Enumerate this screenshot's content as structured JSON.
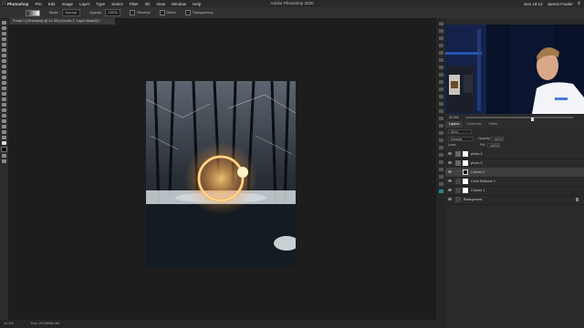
{
  "menubar": {
    "items": [
      "Photoshop",
      "File",
      "Edit",
      "Image",
      "Layer",
      "Type",
      "Select",
      "Filter",
      "3D",
      "View",
      "Window",
      "Help"
    ],
    "clock": "Sun 19:12",
    "user": "James Fowler"
  },
  "window_title": "Adobe Photoshop 2020",
  "options_bar": {
    "mode_label": "Mode:",
    "mode_value": "Normal",
    "opacity_label": "Opacity:",
    "opacity_value": "100%",
    "reverse_label": "Reverse",
    "dither_label": "Dither",
    "transparency_label": "Transparency"
  },
  "document_tab": "Portal 1 (Otherland) @ 41.3% (Curves 2, Layer Mask/8) *",
  "status_bar": {
    "zoom": "41.3%",
    "doc": "Doc: 20.0M/88.4M"
  },
  "navigator": {
    "zoom": "41.3%"
  },
  "panel_tabs": [
    "Layers",
    "Channels",
    "Paths"
  ],
  "layers_panel": {
    "kind_filter": "Kind",
    "blend_mode": "Normal",
    "opacity_label": "Opacity:",
    "opacity_value": "100%",
    "lock_label": "Lock:",
    "fill_label": "Fill:",
    "fill_value": "100%",
    "layers": [
      {
        "name": "photo 1"
      },
      {
        "name": "photo 2"
      },
      {
        "name": "Curves 2"
      },
      {
        "name": "Color Balance 1"
      },
      {
        "name": "Curves 1"
      },
      {
        "name": "Background"
      }
    ]
  },
  "colors": {
    "accent": "#1d8b8b",
    "ring": "#ffb347"
  }
}
